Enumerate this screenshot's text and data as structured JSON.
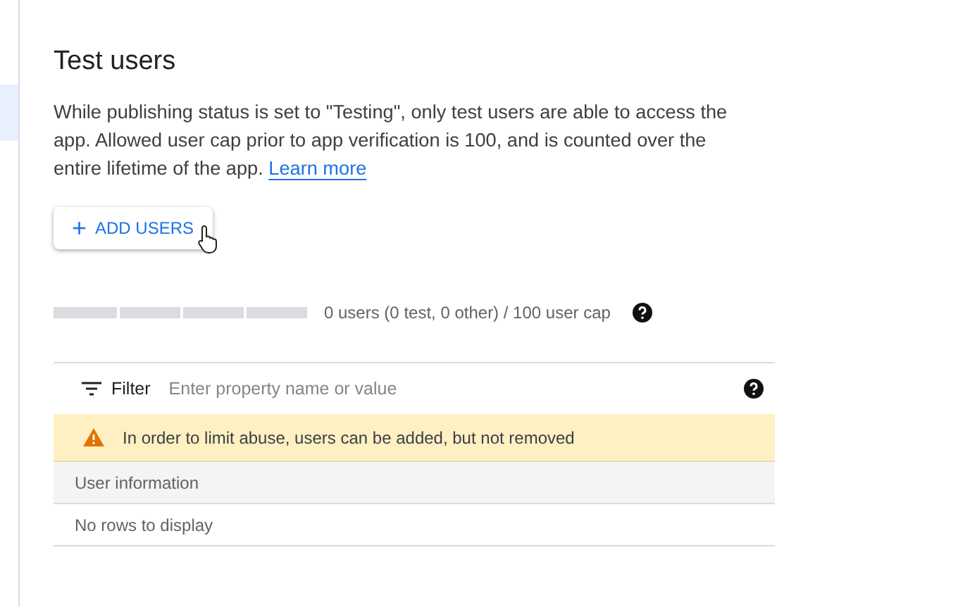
{
  "section": {
    "title": "Test users",
    "description": "While publishing status is set to \"Testing\", only test users are able to access the app. Allowed user cap prior to app verification is 100, and is counted over the entire lifetime of the app.",
    "link": "Learn more"
  },
  "add_button": {
    "icon": "+",
    "label": "ADD USERS"
  },
  "usage": {
    "reading": "0 users (0 test, 0 other) / 100 user cap"
  },
  "table": {
    "filter": {
      "label": "Filter",
      "placeholder": "Enter property name or value"
    },
    "warning": "In order to limit abuse, users can be added, but not removed",
    "columns": [
      "User information"
    ],
    "empty_message": "No rows to display"
  }
}
